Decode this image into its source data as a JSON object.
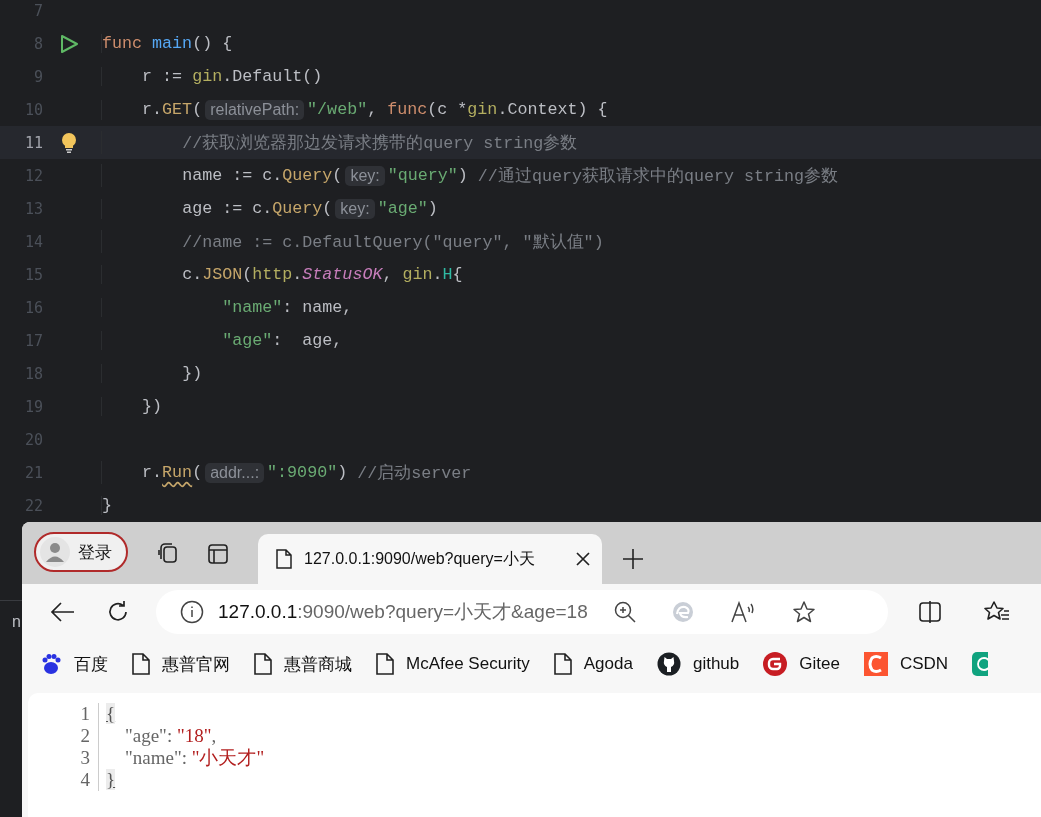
{
  "editor": {
    "lines": [
      {
        "number": "7",
        "current": false,
        "kind": "plain"
      },
      {
        "number": "8",
        "current": false,
        "kind": "run",
        "tokens": [
          {
            "t": "func",
            "kind": "kw"
          },
          {
            "t": " main",
            "kind": "fn"
          },
          {
            "t": "() {",
            "kind": "plain"
          }
        ]
      },
      {
        "number": "9",
        "current": false,
        "tokens": [
          {
            "t": "    r := ",
            "kind": "plain"
          },
          {
            "t": "gin",
            "kind": "pkg"
          },
          {
            "t": ".Default()",
            "kind": "plain"
          }
        ]
      },
      {
        "number": "10",
        "current": false,
        "tokens": [
          {
            "t": "    r.",
            "kind": "plain"
          },
          {
            "t": "GET",
            "kind": "method"
          },
          {
            "t": "(",
            "kind": "plain"
          },
          {
            "t": "relativePath:",
            "kind": "hint"
          },
          {
            "t": "\"/web\"",
            "kind": "str"
          },
          {
            "t": ", ",
            "kind": "plain"
          },
          {
            "t": "func",
            "kind": "kw"
          },
          {
            "t": "(c *",
            "kind": "plain"
          },
          {
            "t": "gin",
            "kind": "pkg"
          },
          {
            "t": ".Context) {",
            "kind": "plain"
          }
        ]
      },
      {
        "number": "11",
        "current": true,
        "kind": "bulb",
        "tokens": [
          {
            "t": "        //获取浏览器那边发请求携带的query string参数",
            "kind": "comment"
          }
        ]
      },
      {
        "number": "12",
        "current": false,
        "tokens": [
          {
            "t": "        name := c.",
            "kind": "plain"
          },
          {
            "t": "Query",
            "kind": "method"
          },
          {
            "t": "(",
            "kind": "plain"
          },
          {
            "t": "key:",
            "kind": "hint"
          },
          {
            "t": "\"query\"",
            "kind": "str"
          },
          {
            "t": ") ",
            "kind": "plain"
          },
          {
            "t": "//通过query获取请求中的query string参数",
            "kind": "comment"
          }
        ]
      },
      {
        "number": "13",
        "current": false,
        "tokens": [
          {
            "t": "        age := c.",
            "kind": "plain"
          },
          {
            "t": "Query",
            "kind": "method"
          },
          {
            "t": "(",
            "kind": "plain"
          },
          {
            "t": "key:",
            "kind": "hint"
          },
          {
            "t": "\"age\"",
            "kind": "str"
          },
          {
            "t": ")",
            "kind": "plain"
          }
        ]
      },
      {
        "number": "14",
        "current": false,
        "tokens": [
          {
            "t": "        //name := c.DefaultQuery(\"query\", \"默认值\")",
            "kind": "comment"
          }
        ]
      },
      {
        "number": "15",
        "current": false,
        "tokens": [
          {
            "t": "        c.",
            "kind": "plain"
          },
          {
            "t": "JSON",
            "kind": "method"
          },
          {
            "t": "(",
            "kind": "plain"
          },
          {
            "t": "http",
            "kind": "pkg"
          },
          {
            "t": ".",
            "kind": "plain"
          },
          {
            "t": "StatusOK",
            "kind": "const"
          },
          {
            "t": ", ",
            "kind": "plain"
          },
          {
            "t": "gin",
            "kind": "pkg"
          },
          {
            "t": ".",
            "kind": "plain"
          },
          {
            "t": "H",
            "kind": "type"
          },
          {
            "t": "{",
            "kind": "plain"
          }
        ]
      },
      {
        "number": "16",
        "current": false,
        "tokens": [
          {
            "t": "            \"name\"",
            "kind": "str"
          },
          {
            "t": ": name,",
            "kind": "plain"
          }
        ]
      },
      {
        "number": "17",
        "current": false,
        "tokens": [
          {
            "t": "            \"age\"",
            "kind": "str"
          },
          {
            "t": ":  age,",
            "kind": "plain"
          }
        ]
      },
      {
        "number": "18",
        "current": false,
        "tokens": [
          {
            "t": "        })",
            "kind": "plain"
          }
        ]
      },
      {
        "number": "19",
        "current": false,
        "tokens": [
          {
            "t": "    })",
            "kind": "plain"
          }
        ]
      },
      {
        "number": "20",
        "current": false,
        "kind": "plain"
      },
      {
        "number": "21",
        "current": false,
        "tokens": [
          {
            "t": "    r.",
            "kind": "plain"
          },
          {
            "t": "Run",
            "kind": "warn"
          },
          {
            "t": "(",
            "kind": "plain"
          },
          {
            "t": "addr...:",
            "kind": "hint"
          },
          {
            "t": "\":9090\"",
            "kind": "str"
          },
          {
            "t": ") ",
            "kind": "plain"
          },
          {
            "t": "//启动server",
            "kind": "comment"
          }
        ]
      },
      {
        "number": "22",
        "current": false,
        "tokens": [
          {
            "t": "}",
            "kind": "plain"
          }
        ]
      }
    ]
  },
  "ide_panel": {
    "fragment": "n"
  },
  "browser": {
    "profile": {
      "label": "登录"
    },
    "tab": {
      "title": "127.0.0.1:9090/web?query=小天"
    },
    "address": {
      "host": "127.0.0.1",
      "rest": ":9090/web?query=小天才&age=18"
    },
    "bookmarks": [
      {
        "kind": "paw",
        "label": "百度"
      },
      {
        "kind": "page",
        "label": "惠普官网"
      },
      {
        "kind": "page",
        "label": "惠普商城"
      },
      {
        "kind": "page",
        "label": "McAfee Security"
      },
      {
        "kind": "page",
        "label": "Agoda"
      },
      {
        "kind": "github",
        "label": "github"
      },
      {
        "kind": "gitee",
        "label": "Gitee"
      },
      {
        "kind": "csdn",
        "label": "CSDN"
      },
      {
        "kind": "knot"
      }
    ],
    "json_view": {
      "lines": [
        {
          "number": "1",
          "tokens": [
            {
              "t": "{",
              "kind": "brace"
            }
          ]
        },
        {
          "number": "2",
          "tokens": [
            {
              "t": "    \"age\"",
              "kind": "key"
            },
            {
              "t": ": ",
              "kind": "plain"
            },
            {
              "t": "\"18\"",
              "kind": "value"
            },
            {
              "t": ",",
              "kind": "plain"
            }
          ]
        },
        {
          "number": "3",
          "tokens": [
            {
              "t": "    \"name\"",
              "kind": "key"
            },
            {
              "t": ": ",
              "kind": "plain"
            },
            {
              "t": "\"小天才\"",
              "kind": "value"
            }
          ]
        },
        {
          "number": "4",
          "tokens": [
            {
              "t": "}",
              "kind": "brace"
            }
          ]
        }
      ]
    }
  }
}
